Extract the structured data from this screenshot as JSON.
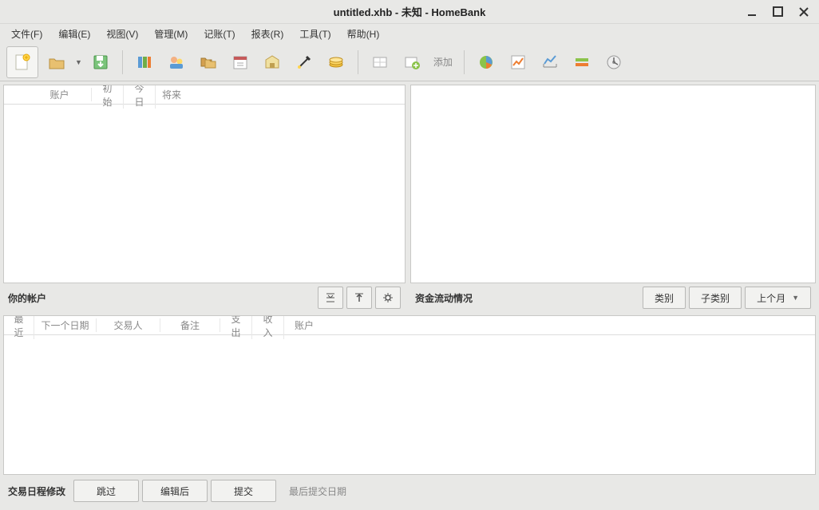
{
  "window": {
    "title": "untitled.xhb - 未知 - HomeBank"
  },
  "menu": {
    "file": "文件(F)",
    "edit": "编辑(E)",
    "view": "视图(V)",
    "manage": "管理(M)",
    "transactions": "记账(T)",
    "reports": "报表(R)",
    "tools": "工具(T)",
    "help": "帮助(H)"
  },
  "toolbar": {
    "add_label": "添加"
  },
  "accounts_panel": {
    "title": "你的帐户",
    "headers": {
      "account": "账户",
      "initial": "初始",
      "today": "今日",
      "future": "将来"
    }
  },
  "flow_panel": {
    "title": "资金流动情况",
    "category_label": "类别",
    "subcategory_label": "子类别",
    "range_label": "上个月"
  },
  "schedule_panel": {
    "headers": {
      "recent": "最近",
      "next_date": "下一个日期",
      "payee": "交易人",
      "memo": "备注",
      "expense": "支出",
      "income": "收入",
      "account": "账户"
    },
    "title": "交易日程修改",
    "skip_label": "跳过",
    "edit_post_label": "编辑后",
    "post_label": "提交",
    "last_post_label": "最后提交日期"
  }
}
